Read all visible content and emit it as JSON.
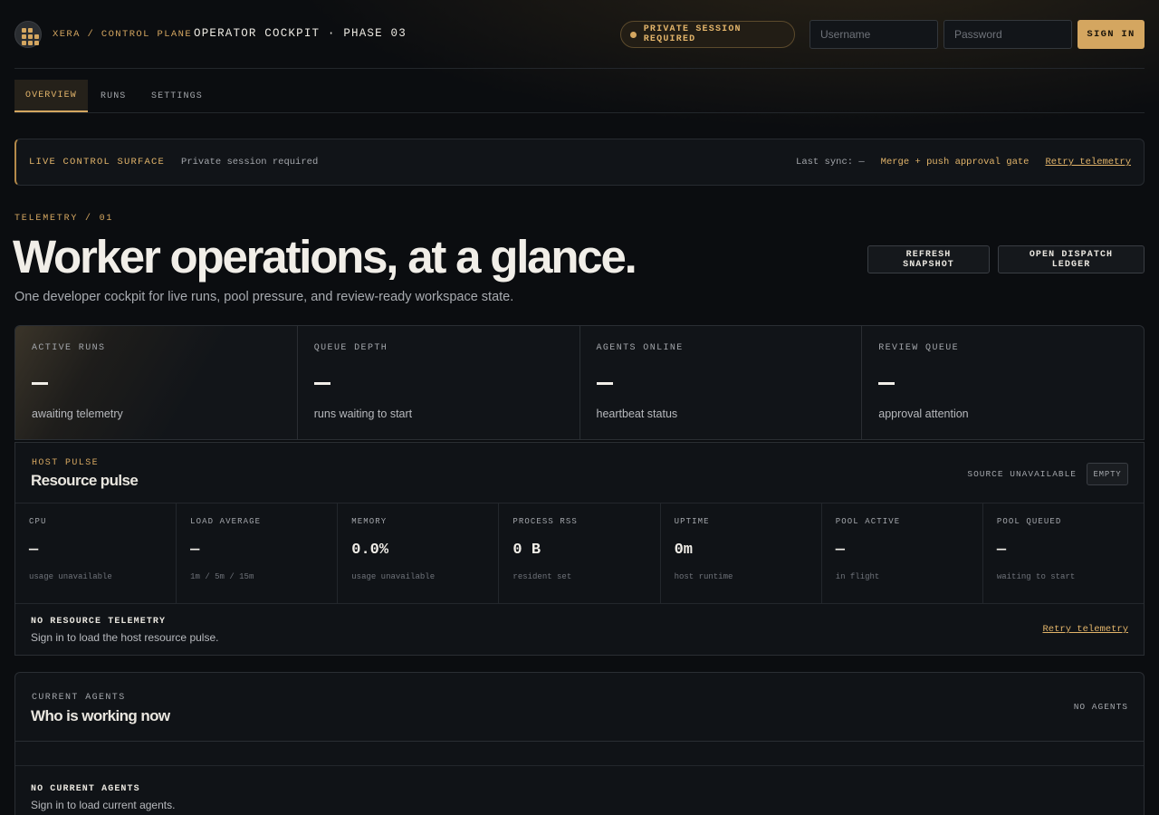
{
  "brand": {
    "sub": "XERA / CONTROL PLANE",
    "title": "OPERATOR COCKPIT · PHASE 03"
  },
  "session": {
    "label": "PRIVATE SESSION REQUIRED"
  },
  "login": {
    "username_placeholder": "Username",
    "password_placeholder": "Password",
    "sign_in_label": "SIGN IN"
  },
  "tabs": [
    {
      "label": "OVERVIEW",
      "active": true
    },
    {
      "label": "RUNS",
      "active": false
    },
    {
      "label": "SETTINGS",
      "active": false
    }
  ],
  "banner": {
    "label": "LIVE CONTROL SURFACE",
    "status": "Private session required",
    "sync": "Last sync: —",
    "gate": "Merge + push approval gate",
    "retry": "Retry telemetry"
  },
  "hero": {
    "eyebrow": "TELEMETRY / 01",
    "title": "Worker operations, at a glance.",
    "subtitle": "One developer cockpit for live runs, pool pressure, and review-ready workspace state.",
    "refresh_label": "REFRESH SNAPSHOT",
    "ledger_label": "OPEN DISPATCH LEDGER"
  },
  "stats": [
    {
      "label": "ACTIVE RUNS",
      "value": "—",
      "desc": "awaiting telemetry"
    },
    {
      "label": "QUEUE DEPTH",
      "value": "—",
      "desc": "runs waiting to start"
    },
    {
      "label": "AGENTS ONLINE",
      "value": "—",
      "desc": "heartbeat status"
    },
    {
      "label": "REVIEW QUEUE",
      "value": "—",
      "desc": "approval attention"
    }
  ],
  "pulse": {
    "label": "HOST PULSE",
    "title": "Resource pulse",
    "source": "SOURCE UNAVAILABLE",
    "chip": "EMPTY",
    "metrics": [
      {
        "label": "CPU",
        "value": "—",
        "desc": "usage unavailable"
      },
      {
        "label": "LOAD AVERAGE",
        "value": "—",
        "desc": "1m / 5m / 15m"
      },
      {
        "label": "MEMORY",
        "value": "0.0%",
        "desc": "usage unavailable"
      },
      {
        "label": "PROCESS RSS",
        "value": "0 B",
        "desc": "resident set"
      },
      {
        "label": "UPTIME",
        "value": "0m",
        "desc": "host runtime"
      },
      {
        "label": "POOL ACTIVE",
        "value": "—",
        "desc": "in flight"
      },
      {
        "label": "POOL QUEUED",
        "value": "—",
        "desc": "waiting to start"
      }
    ],
    "empty_title": "NO RESOURCE TELEMETRY",
    "empty_sub": "Sign in to load the host resource pulse.",
    "retry": "Retry telemetry"
  },
  "agents": {
    "label": "CURRENT AGENTS",
    "title": "Who is working now",
    "status": "NO AGENTS",
    "empty_title": "NO CURRENT AGENTS",
    "empty_sub": "Sign in to load current agents."
  },
  "colors": {
    "accent": "#d4a660",
    "background": "#0b0d10",
    "panel": "#111418"
  }
}
